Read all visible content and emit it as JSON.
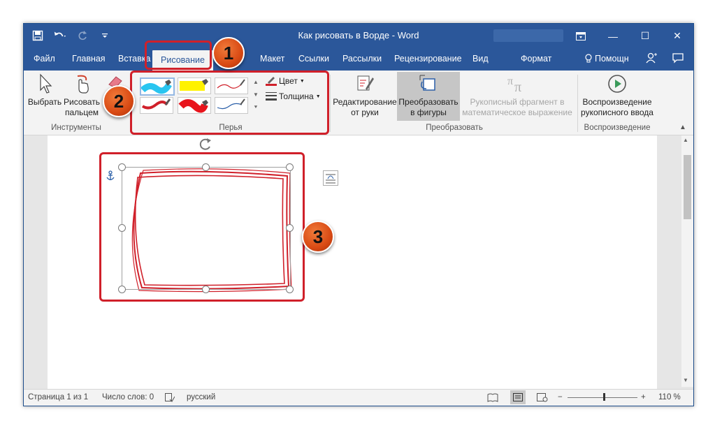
{
  "window": {
    "title": "Как рисовать в Ворде  -  Word",
    "quick_access": {
      "save_icon": "save-icon",
      "undo_icon": "undo-icon",
      "redo_icon": "redo-icon",
      "customize_icon": "customize-qat-icon"
    },
    "controls": {
      "ribbon_display_icon": "ribbon-display-icon",
      "minimize": "—",
      "maximize": "☐",
      "close": "✕"
    }
  },
  "tabs": [
    {
      "label": "Файл"
    },
    {
      "label": "Главная"
    },
    {
      "label": "Вставка"
    },
    {
      "label": "Рисование",
      "active": true
    },
    {
      "label": "Макет"
    },
    {
      "label": "Ссылки"
    },
    {
      "label": "Рассылки"
    },
    {
      "label": "Рецензирование"
    },
    {
      "label": "Вид"
    },
    {
      "label": "Формат"
    },
    {
      "label": "Помощн"
    }
  ],
  "ribbon": {
    "tools": {
      "select_label": "Выбрать",
      "draw_finger_line1": "Рисовать",
      "draw_finger_line2": "пальцем",
      "group_label": "Инструменты"
    },
    "pens": {
      "items": [
        {
          "color": "#29c5f0",
          "kind": "highlighter"
        },
        {
          "color": "#fff200",
          "kind": "highlighter"
        },
        {
          "color": "#d0202a",
          "kind": "pen-thin"
        },
        {
          "color": "#d0202a",
          "kind": "pen-thick"
        },
        {
          "color": "#e8141c",
          "kind": "highlighter"
        },
        {
          "color": "#2b5fa8",
          "kind": "pen-thin"
        }
      ],
      "color_label": "Цвет",
      "thickness_label": "Толщина",
      "group_label": "Перья"
    },
    "convert": {
      "edit_line1": "Редактирование",
      "edit_line2": "от руки",
      "shapes_line1": "Преобразовать",
      "shapes_line2": "в фигуры",
      "math_line1": "Рукописный фрагмент в",
      "math_line2": "математическое выражение",
      "group_label": "Преобразовать"
    },
    "replay": {
      "line1": "Воспроизведение",
      "line2": "рукописного ввода",
      "group_label": "Воспроизведение"
    }
  },
  "callouts": [
    "1",
    "2",
    "3"
  ],
  "statusbar": {
    "page": "Страница 1 из 1",
    "words": "Число слов: 0",
    "language": "русский",
    "zoom": "110 %",
    "zoom_minus": "−",
    "zoom_plus": "+"
  },
  "colors": {
    "brand": "#2b579a",
    "callout": "#d94a14",
    "highlight_box": "#d0202a"
  }
}
